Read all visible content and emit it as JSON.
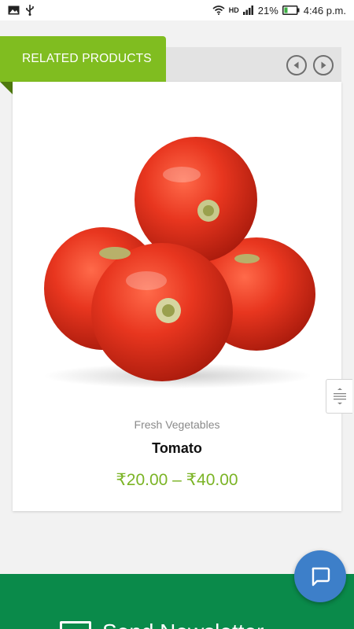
{
  "status_bar": {
    "battery": "21%",
    "time": "4:46 p.m.",
    "network": "HD"
  },
  "related": {
    "heading": "RELATED PRODUCTS",
    "prev_icon": "triangle-left-icon",
    "next_icon": "triangle-right-icon"
  },
  "product": {
    "category": "Fresh Vegetables",
    "title": "Tomato",
    "price": "₹20.00 – ₹40.00"
  },
  "footer": {
    "newsletter_text": "Send Newsletter"
  },
  "colors": {
    "accent_green": "#80bd20",
    "price_green": "#7bb425",
    "footer_green": "#0a8a4a",
    "chat_blue": "#3d7fc9"
  }
}
